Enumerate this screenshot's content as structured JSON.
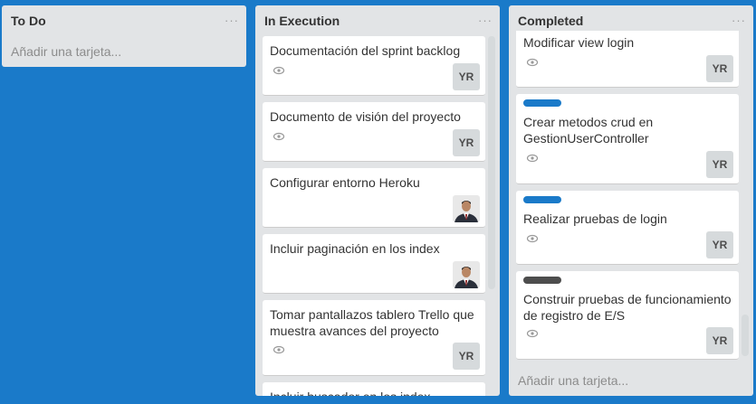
{
  "lists": {
    "todo": {
      "title": "To Do",
      "menu": "···",
      "add": "Añadir una tarjeta..."
    },
    "exec": {
      "title": "In Execution",
      "menu": "···",
      "cards": [
        {
          "title": "Documentación del sprint backlog",
          "member": "YR"
        },
        {
          "title": "Documento de visión del proyecto",
          "member": "YR"
        },
        {
          "title": "Configurar entorno Heroku"
        },
        {
          "title": "Incluir paginación en los index"
        },
        {
          "title": "Tomar pantallazos tablero Trello que muestra avances del proyecto",
          "member": "YR"
        },
        {
          "title": "Incluir buscador en los index"
        }
      ]
    },
    "done": {
      "title": "Completed",
      "menu": "···",
      "add": "Añadir una tarjeta...",
      "cards": [
        {
          "title": "Modificar view login",
          "member": "YR"
        },
        {
          "title": "Crear metodos crud en GestionUserController",
          "member": "YR",
          "label_color": "#1a7ac9"
        },
        {
          "title": "Realizar pruebas de login",
          "member": "YR",
          "label_color": "#1a7ac9"
        },
        {
          "title": "Construir pruebas de funcionamiento de registro de E/S",
          "member": "YR",
          "label_color": "#4d4d4d"
        }
      ]
    }
  },
  "icons": {
    "watch": "eye-icon",
    "more": "ellipsis-icon"
  },
  "colors": {
    "board_bg": "#1a7ac9",
    "list_bg": "#e2e4e6",
    "card_bg": "#ffffff",
    "avatar_bg": "#d6dadc"
  }
}
